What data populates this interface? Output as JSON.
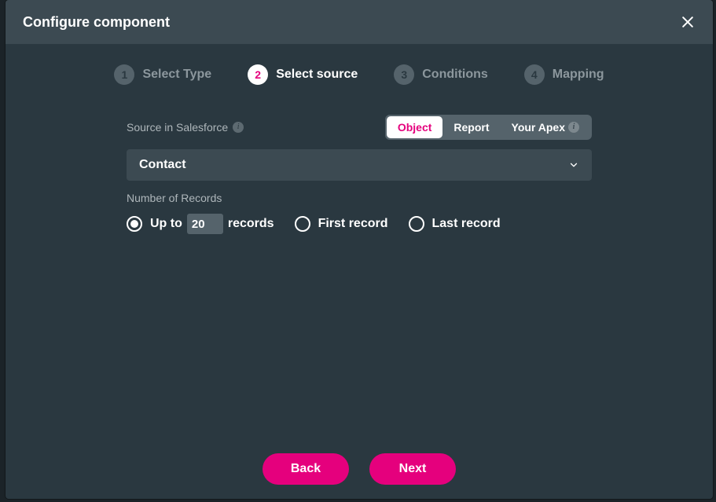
{
  "header": {
    "title": "Configure component"
  },
  "steps": [
    {
      "num": "1",
      "label": "Select Type"
    },
    {
      "num": "2",
      "label": "Select source"
    },
    {
      "num": "3",
      "label": "Conditions"
    },
    {
      "num": "4",
      "label": "Mapping"
    }
  ],
  "active_step_index": 1,
  "source": {
    "label": "Source in Salesforce",
    "tabs": [
      "Object",
      "Report",
      "Your Apex"
    ],
    "active_tab_index": 0,
    "selected_value": "Contact"
  },
  "records": {
    "label": "Number of Records",
    "options": {
      "upto_prefix": "Up to",
      "upto_value": "20",
      "upto_suffix": "records",
      "first": "First record",
      "last": "Last record"
    },
    "selected": "upto"
  },
  "footer": {
    "back": "Back",
    "next": "Next"
  }
}
